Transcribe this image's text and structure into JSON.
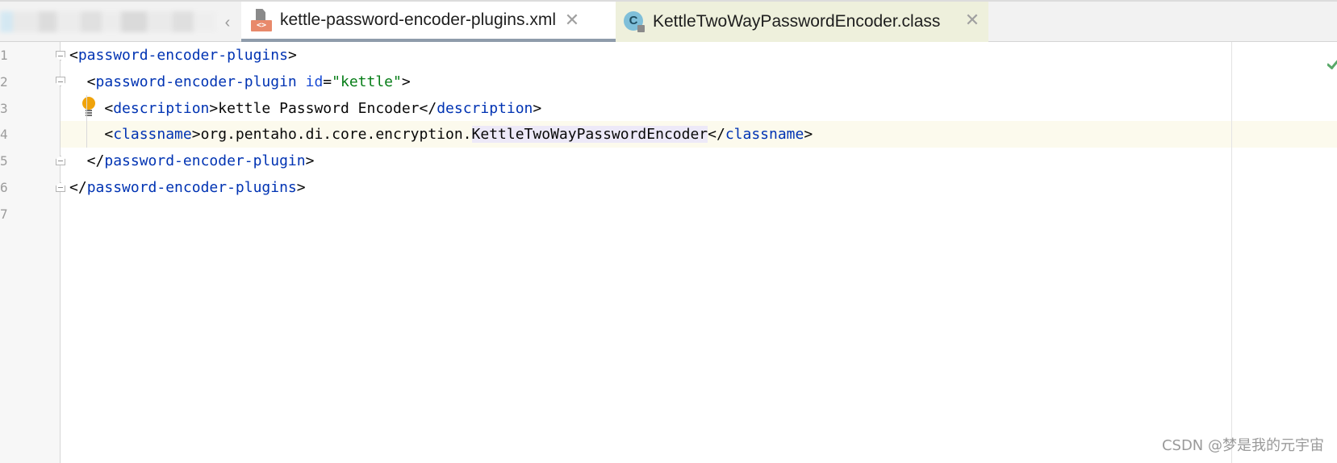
{
  "tabs": {
    "scroll_left_glyph": "‹",
    "items": [
      {
        "label": "kettle-password-encoder-plugins.xml",
        "icon": "xml-file-icon",
        "icon_badge": "<>",
        "close_glyph": "✕",
        "active": true
      },
      {
        "label": "KettleTwoWayPasswordEncoder.class",
        "icon": "class-file-icon",
        "icon_letter": "C",
        "close_glyph": "✕",
        "active": false
      }
    ]
  },
  "editor": {
    "line_numbers": [
      "1",
      "2",
      "3",
      "4",
      "5",
      "6",
      "7"
    ],
    "current_line": 4,
    "lines": [
      {
        "tokens": [
          {
            "t": "<",
            "k": "punct"
          },
          {
            "t": "password-encoder-plugins",
            "k": "tag"
          },
          {
            "t": ">",
            "k": "punct"
          }
        ]
      },
      {
        "tokens": [
          {
            "t": "  <",
            "k": "punct"
          },
          {
            "t": "password-encoder-plugin",
            "k": "tag"
          },
          {
            "t": " ",
            "k": "text"
          },
          {
            "t": "id",
            "k": "attr"
          },
          {
            "t": "=",
            "k": "punct"
          },
          {
            "t": "\"kettle\"",
            "k": "str"
          },
          {
            "t": ">",
            "k": "punct"
          }
        ]
      },
      {
        "tokens": [
          {
            "t": "    <",
            "k": "punct"
          },
          {
            "t": "description",
            "k": "tag"
          },
          {
            "t": ">",
            "k": "punct"
          },
          {
            "t": "kettle Password Encoder",
            "k": "text"
          },
          {
            "t": "</",
            "k": "punct"
          },
          {
            "t": "description",
            "k": "tag"
          },
          {
            "t": ">",
            "k": "punct"
          }
        ]
      },
      {
        "tokens": [
          {
            "t": "    <",
            "k": "punct"
          },
          {
            "t": "classname",
            "k": "tag"
          },
          {
            "t": ">",
            "k": "punct"
          },
          {
            "t": "org.pentaho.di.core.encryption.",
            "k": "text"
          },
          {
            "t": "KettleTwoWayPasswordEncoder",
            "k": "hl"
          },
          {
            "t": "</",
            "k": "punct"
          },
          {
            "t": "classname",
            "k": "tag"
          },
          {
            "t": ">",
            "k": "punct"
          }
        ]
      },
      {
        "tokens": [
          {
            "t": "  </",
            "k": "punct"
          },
          {
            "t": "password-encoder-plugin",
            "k": "tag"
          },
          {
            "t": ">",
            "k": "punct"
          }
        ]
      },
      {
        "tokens": [
          {
            "t": "</",
            "k": "punct"
          },
          {
            "t": "password-encoder-plugins",
            "k": "tag"
          },
          {
            "t": ">",
            "k": "punct"
          }
        ]
      },
      {
        "tokens": []
      }
    ]
  },
  "watermark": "CSDN @梦是我的元宇宙",
  "colors": {
    "tag": "#0033b3",
    "attribute": "#174ad4",
    "string": "#067d17",
    "current_line_bg": "#fcfaed",
    "intention_bulb": "#f0a30a",
    "inspection_ok": "#59a869"
  }
}
